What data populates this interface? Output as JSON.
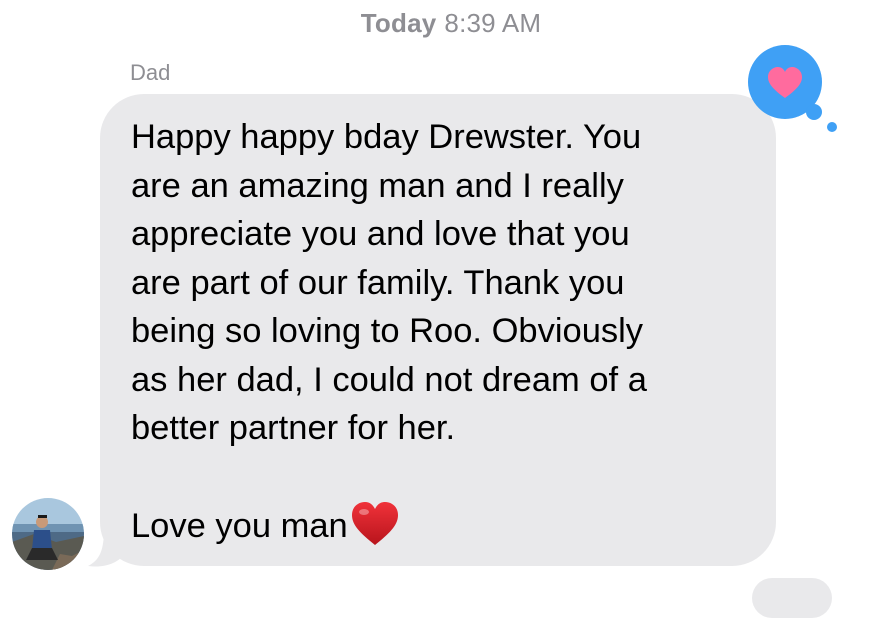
{
  "timestamp": {
    "day": "Today",
    "time": "8:39 AM"
  },
  "message": {
    "sender": "Dad",
    "body": "Happy happy bday Drewster. You\nare an amazing man and I really\nappreciate you and love that you\nare part of our family. Thank you\nbeing so loving to Roo. Obviously\nas her dad, I could not dream of a\nbetter partner for her.\n\nLove you man",
    "emoji": "heart-emoji",
    "reaction": "heart-tapback-icon"
  },
  "colors": {
    "bubble": "#e9e9eb",
    "meta_text": "#8e8e93",
    "reaction_bg": "#3fa0f5",
    "reaction_heart": "#ff6b9e",
    "emoji_heart": "#e01b24"
  }
}
